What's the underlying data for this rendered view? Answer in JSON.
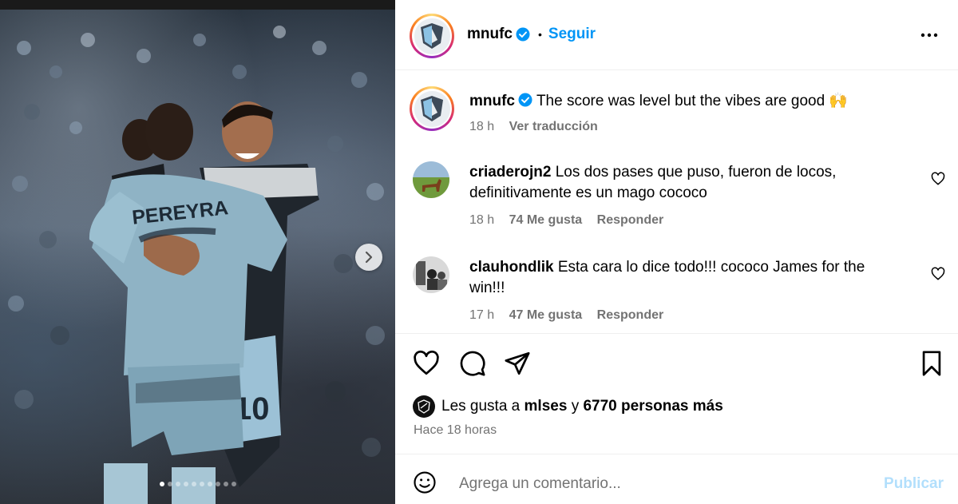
{
  "post": {
    "username": "mnufc",
    "follow_label": "Seguir",
    "separator": "•"
  },
  "caption": {
    "username": "mnufc",
    "text": "The score was level but the vibes are good 🙌",
    "time": "18 h",
    "translate_label": "Ver traducción"
  },
  "comments": [
    {
      "username": "criaderojn2",
      "text": "Los dos pases que puso, fueron de locos, definitivamente es un mago cococo",
      "time": "18 h",
      "likes": "74 Me gusta",
      "reply_label": "Responder"
    },
    {
      "username": "clauhondlik",
      "text": "Esta cara lo dice todo!!! cococo James for the win!!!",
      "time": "17 h",
      "likes": "47 Me gusta",
      "reply_label": "Responder"
    }
  ],
  "likes": {
    "prefix": "Les gusta a",
    "user": "mlses",
    "conj": "y",
    "others": "6770 personas más"
  },
  "time_ago": "Hace 18 horas",
  "comment_box": {
    "placeholder": "Agrega un comentario...",
    "post_label": "Publicar"
  },
  "media": {
    "jersey_name": "PEREYRA",
    "jersey_number": "10",
    "carousel_total": 10,
    "carousel_active": 1
  },
  "colors": {
    "accent": "#0095f6",
    "muted": "#737373",
    "post_disabled": "#b2dffc"
  },
  "icons": [
    "verified-icon",
    "more-options-icon",
    "heart-icon",
    "comment-icon",
    "share-icon",
    "bookmark-icon",
    "emoji-icon",
    "chevron-right-icon"
  ]
}
